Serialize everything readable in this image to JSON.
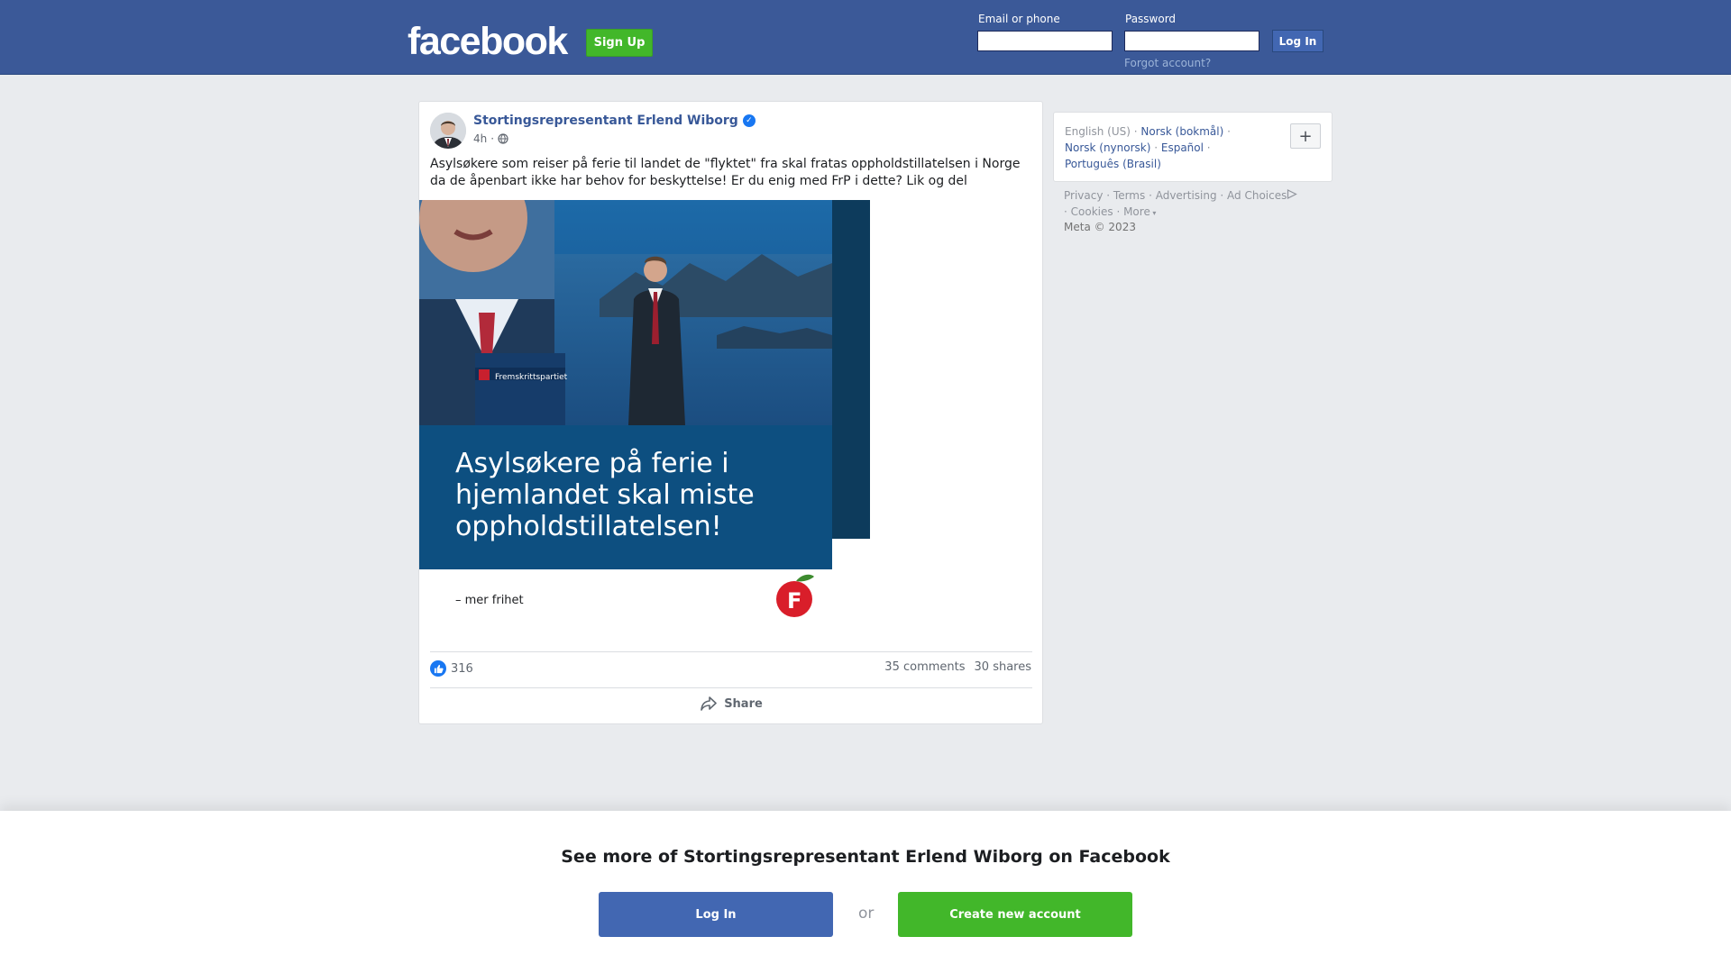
{
  "header": {
    "logo": "facebook",
    "signup_label": "Sign Up",
    "email_label": "Email or phone",
    "email_value": "",
    "password_label": "Password",
    "password_value": "",
    "login_label": "Log In",
    "forgot_label": "Forgot account?"
  },
  "post": {
    "author": "Stortingsrepresentant Erlend Wiborg",
    "time": "4h",
    "separator": "·",
    "text": "Asylsøkere som reiser på ferie til landet de \"flyktet\" fra skal fratas oppholdstillatelsen i Norge da de åpenbart ikke har behov for beskyttelse! Er du enig med FrP i dette? Lik og del",
    "image": {
      "podium_text": "Fremskrittspartiet",
      "headline_lines": [
        "Asylsøkere på ferie i",
        "hjemlandet skal miste",
        "oppholdstillatelsen!"
      ],
      "slogan": "– mer frihet",
      "logo_letter": "F"
    },
    "reaction_count": "316",
    "comments": "35 comments",
    "shares": "30 shares",
    "share_label": "Share"
  },
  "sidebar": {
    "languages": [
      {
        "label": "English (US)",
        "link": false
      },
      {
        "label": "Norsk (bokmål)",
        "link": true
      },
      {
        "label": "Norsk (nynorsk)",
        "link": true
      },
      {
        "label": "Español",
        "link": true
      },
      {
        "label": "Português (Brasil)",
        "link": true
      }
    ],
    "plus_label": "+",
    "footer_links": [
      "Privacy",
      "Terms",
      "Advertising",
      "Ad Choices",
      "Cookies",
      "More"
    ],
    "copyright": "Meta © 2023"
  },
  "bottom": {
    "title": "See more of Stortingsrepresentant Erlend Wiborg on Facebook",
    "login_label": "Log In",
    "or_label": "or",
    "create_label": "Create new account"
  },
  "colors": {
    "brand_blue": "#3b5998",
    "button_blue": "#4267b2",
    "green": "#42b72a",
    "link": "#385898"
  }
}
